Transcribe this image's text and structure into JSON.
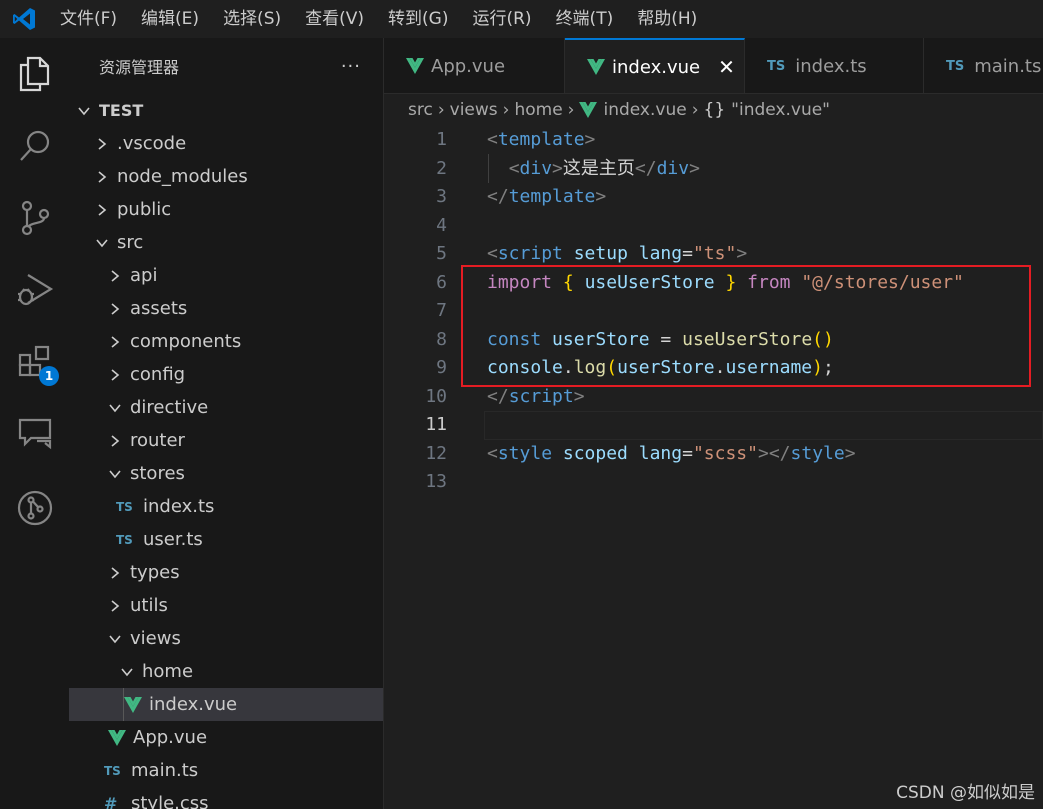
{
  "menu": [
    "文件(F)",
    "编辑(E)",
    "选择(S)",
    "查看(V)",
    "转到(G)",
    "运行(R)",
    "终端(T)",
    "帮助(H)"
  ],
  "activity": {
    "extensions_badge": "1"
  },
  "sidebar": {
    "title": "资源管理器",
    "more": "···",
    "tree": [
      {
        "label": "TEST",
        "kind": "root"
      },
      {
        "label": ".vscode",
        "kind": "folder-closed"
      },
      {
        "label": "node_modules",
        "kind": "folder-closed"
      },
      {
        "label": "public",
        "kind": "folder-closed"
      },
      {
        "label": "src",
        "kind": "folder-open"
      },
      {
        "label": "api",
        "kind": "folder-closed"
      },
      {
        "label": "assets",
        "kind": "folder-closed"
      },
      {
        "label": "components",
        "kind": "folder-closed"
      },
      {
        "label": "config",
        "kind": "folder-closed"
      },
      {
        "label": "directive",
        "kind": "folder-open"
      },
      {
        "label": "router",
        "kind": "folder-closed"
      },
      {
        "label": "stores",
        "kind": "folder-open"
      },
      {
        "label": "index.ts",
        "kind": "ts"
      },
      {
        "label": "user.ts",
        "kind": "ts"
      },
      {
        "label": "types",
        "kind": "folder-closed"
      },
      {
        "label": "utils",
        "kind": "folder-closed"
      },
      {
        "label": "views",
        "kind": "folder-open"
      },
      {
        "label": "home",
        "kind": "folder-open"
      },
      {
        "label": "index.vue",
        "kind": "vue"
      },
      {
        "label": "App.vue",
        "kind": "vue"
      },
      {
        "label": "main.ts",
        "kind": "ts"
      },
      {
        "label": "style.css",
        "kind": "css"
      }
    ],
    "ts_badge": "TS",
    "css_badge": "#"
  },
  "tabs": [
    {
      "label": "App.vue",
      "kind": "vue"
    },
    {
      "label": "index.vue",
      "kind": "vue",
      "active": true,
      "close": "✕"
    },
    {
      "label": "index.ts",
      "kind": "ts"
    },
    {
      "label": "main.ts",
      "kind": "ts"
    }
  ],
  "breadcrumb": {
    "src": "src",
    "views": "views",
    "home": "home",
    "file": "index.vue",
    "symbol_icon": "{}",
    "symbol": "\"index.vue\"",
    "sep": "›"
  },
  "editor": {
    "current_line": 11,
    "lines": [
      {
        "n": "1"
      },
      {
        "n": "2"
      },
      {
        "n": "3"
      },
      {
        "n": "4"
      },
      {
        "n": "5"
      },
      {
        "n": "6"
      },
      {
        "n": "7"
      },
      {
        "n": "8"
      },
      {
        "n": "9"
      },
      {
        "n": "10"
      },
      {
        "n": "11"
      },
      {
        "n": "12"
      },
      {
        "n": "13"
      }
    ],
    "tokens": {
      "l1": [
        "<",
        "template",
        ">"
      ],
      "l2": [
        "<",
        "div",
        ">",
        "这是主页",
        "</",
        "div",
        ">"
      ],
      "l3": [
        "</",
        "template",
        ">"
      ],
      "l5": [
        "<",
        "script",
        " ",
        "setup",
        " ",
        "lang",
        "=",
        "\"ts\"",
        ">"
      ],
      "l6": [
        "import",
        " ",
        "{",
        " ",
        "useUserStore",
        " ",
        "}",
        " ",
        "from",
        " ",
        "\"@/stores/user\""
      ],
      "l8": [
        "const",
        " ",
        "userStore",
        " ",
        "=",
        " ",
        "useUserStore",
        "()"
      ],
      "l9": [
        "console",
        ".",
        "log",
        "(",
        "userStore",
        ".",
        "username",
        ")",
        ";"
      ],
      "l10": [
        "</",
        "script",
        ">"
      ],
      "l12": [
        "<",
        "style",
        " ",
        "scoped",
        " ",
        "lang",
        "=",
        "\"scss\"",
        ">",
        "</",
        "style",
        ">"
      ]
    }
  },
  "watermark": "CSDN @如似如是",
  "colors": {
    "accent": "#0078d4",
    "highlight_box": "#e51c23",
    "vue_green": "#41b883"
  }
}
